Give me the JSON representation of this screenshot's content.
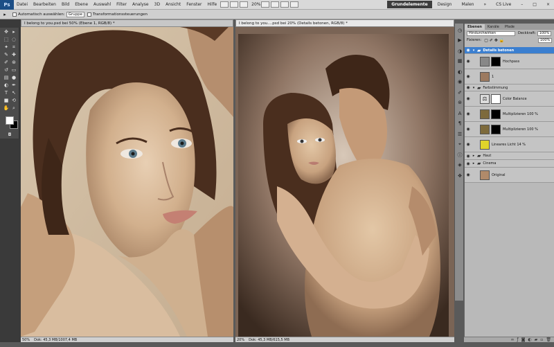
{
  "menubar": {
    "app_logo": "Ps",
    "items": [
      "Datei",
      "Bearbeiten",
      "Bild",
      "Ebene",
      "Auswahl",
      "Filter",
      "Analyse",
      "3D",
      "Ansicht",
      "Fenster",
      "Hilfe"
    ],
    "zoom": "20%",
    "workspaces": {
      "active": "Grundelemente",
      "design": "Design",
      "painting": "Malen"
    },
    "live": "CS Live"
  },
  "options": {
    "auto_select_label": "Automatisch auswählen:",
    "auto_select_value": "Gruppe",
    "transform_label": "Transformationssteuerungen"
  },
  "doc1": {
    "tab": "I belong to you.psd bei 50% (Ebene 1, RGB/8) *",
    "zoom": "50%",
    "size": "Dok: 45,3 MB/1007,4 MB"
  },
  "doc2": {
    "tab": "I belong to you....psd bei 20% (Details betonen, RGB/8) *",
    "zoom": "20%",
    "size": "Dok: 45,3 MB/615,5 MB"
  },
  "layers": {
    "tabs": [
      "Ebenen",
      "Kanäle",
      "Pfade"
    ],
    "blend_mode": "Hindurchwirken",
    "opacity_label": "Deckkraft:",
    "opacity_value": "100%",
    "fill_label": "Fixieren:",
    "fill_value": "100%",
    "items": [
      {
        "name": "Details betonen"
      },
      {
        "name": "Hochpass"
      },
      {
        "name": "1"
      },
      {
        "name": "Farbstimmung"
      },
      {
        "name": "Color Balance"
      },
      {
        "name": "Multiplizieren 100 %"
      },
      {
        "name": "Multiplizieren 100 %"
      },
      {
        "name": "Lineares Licht 14 %"
      },
      {
        "name": "Haut"
      },
      {
        "name": "Cinema"
      },
      {
        "name": "Original"
      }
    ]
  },
  "colors": {
    "selected_layer": "#3b7fd0",
    "workspace_active": "#3d3d3d",
    "yellow_fill": "#e0d42a",
    "brown_fill": "#7d6a3c"
  }
}
